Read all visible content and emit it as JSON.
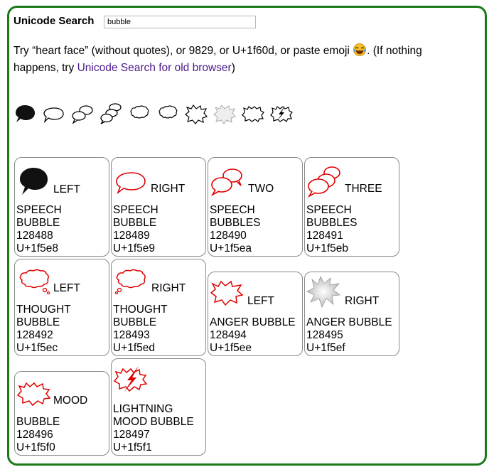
{
  "header": {
    "title": "Unicode Search",
    "search_value": "bubble"
  },
  "help": {
    "line1_a": "Try “heart face” (without quotes), or 9829, or U+1f60d, or paste emoji ",
    "line1_b": ". (If nothing",
    "line2_a": "happens, try ",
    "link": "Unicode Search for old browser",
    "line2_b": ")"
  },
  "strip_icons": [
    "speech-bubble-left-icon",
    "speech-bubble-right-icon",
    "two-speech-bubbles-icon",
    "three-speech-bubbles-icon",
    "thought-bubble-left-icon",
    "thought-bubble-right-icon",
    "anger-bubble-left-icon",
    "anger-bubble-right-icon",
    "mood-bubble-icon",
    "lightning-mood-bubble-icon"
  ],
  "cards": [
    {
      "word": "LEFT",
      "rest": "SPEECH\nBUBBLE\n128488\nU+1f5e8",
      "icon": "speech-bubble-left-icon"
    },
    {
      "word": "RIGHT",
      "rest": "SPEECH\nBUBBLE\n128489\nU+1f5e9",
      "icon": "speech-bubble-right-icon"
    },
    {
      "word": "TWO",
      "rest": "SPEECH\nBUBBLES\n128490\nU+1f5ea",
      "icon": "two-speech-bubbles-icon"
    },
    {
      "word": "THREE",
      "rest": "SPEECH\nBUBBLES\n128491\nU+1f5eb",
      "icon": "three-speech-bubbles-icon"
    },
    {
      "word": "LEFT",
      "rest": "THOUGHT\nBUBBLE\n128492\nU+1f5ec",
      "icon": "thought-bubble-left-icon"
    },
    {
      "word": "RIGHT",
      "rest": "THOUGHT\nBUBBLE\n128493\nU+1f5ed",
      "icon": "thought-bubble-right-icon"
    },
    {
      "word": "LEFT",
      "rest": "ANGER BUBBLE\n128494\nU+1f5ee",
      "icon": "anger-bubble-left-icon"
    },
    {
      "word": "RIGHT",
      "rest": "ANGER BUBBLE\n128495\nU+1f5ef",
      "icon": "anger-bubble-right-icon"
    },
    {
      "word": "MOOD",
      "rest": "BUBBLE\n128496\nU+1f5f0",
      "icon": "mood-bubble-icon"
    },
    {
      "word": "",
      "rest": "LIGHTNING\nMOOD BUBBLE\n128497\nU+1f5f1",
      "icon": "lightning-mood-bubble-icon"
    }
  ],
  "colors": {
    "frame": "#1a7a1a",
    "glyph_red": "#e00000",
    "link": "#4b1a8a"
  }
}
